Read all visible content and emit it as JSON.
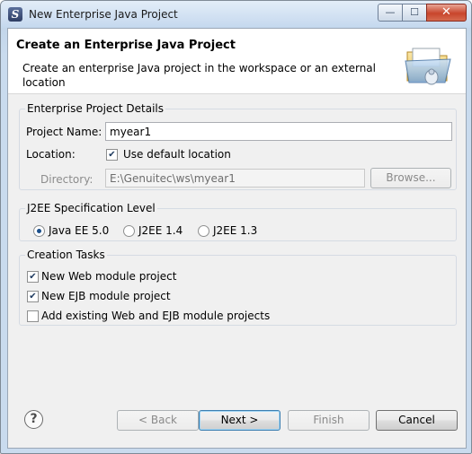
{
  "window": {
    "title": "New Enterprise Java Project",
    "app_icon_glyph": "S",
    "controls": {
      "minimize": "—",
      "maximize": "☐",
      "close": "✕"
    }
  },
  "header": {
    "title": "Create an Enterprise Java Project",
    "description": "Create an enterprise Java project in the workspace or an external location",
    "icon": "folder-wizard-icon"
  },
  "project_details": {
    "legend": "Enterprise Project Details",
    "project_name_label": "Project Name:",
    "project_name_value": "myear1",
    "location_label": "Location:",
    "use_default_label": "Use default location",
    "use_default_checked": true,
    "directory_label": "Directory:",
    "directory_value": "E:\\Genuitec\\ws\\myear1",
    "browse_label": "Browse..."
  },
  "spec_level": {
    "legend": "J2EE Specification Level",
    "options": [
      {
        "label": "Java EE 5.0",
        "selected": true
      },
      {
        "label": "J2EE 1.4",
        "selected": false
      },
      {
        "label": "J2EE 1.3",
        "selected": false
      }
    ]
  },
  "creation_tasks": {
    "legend": "Creation Tasks",
    "items": [
      {
        "label": "New Web module project",
        "checked": true
      },
      {
        "label": "New EJB module project",
        "checked": true
      },
      {
        "label": "Add existing Web and EJB module projects",
        "checked": false
      }
    ]
  },
  "footer": {
    "help_glyph": "?",
    "back_label": "< Back",
    "next_label": "Next >",
    "finish_label": "Finish",
    "cancel_label": "Cancel"
  },
  "colors": {
    "accent": "#3c7fb1",
    "title_bar": "#c4d8ee",
    "close_button": "#c8452c"
  }
}
